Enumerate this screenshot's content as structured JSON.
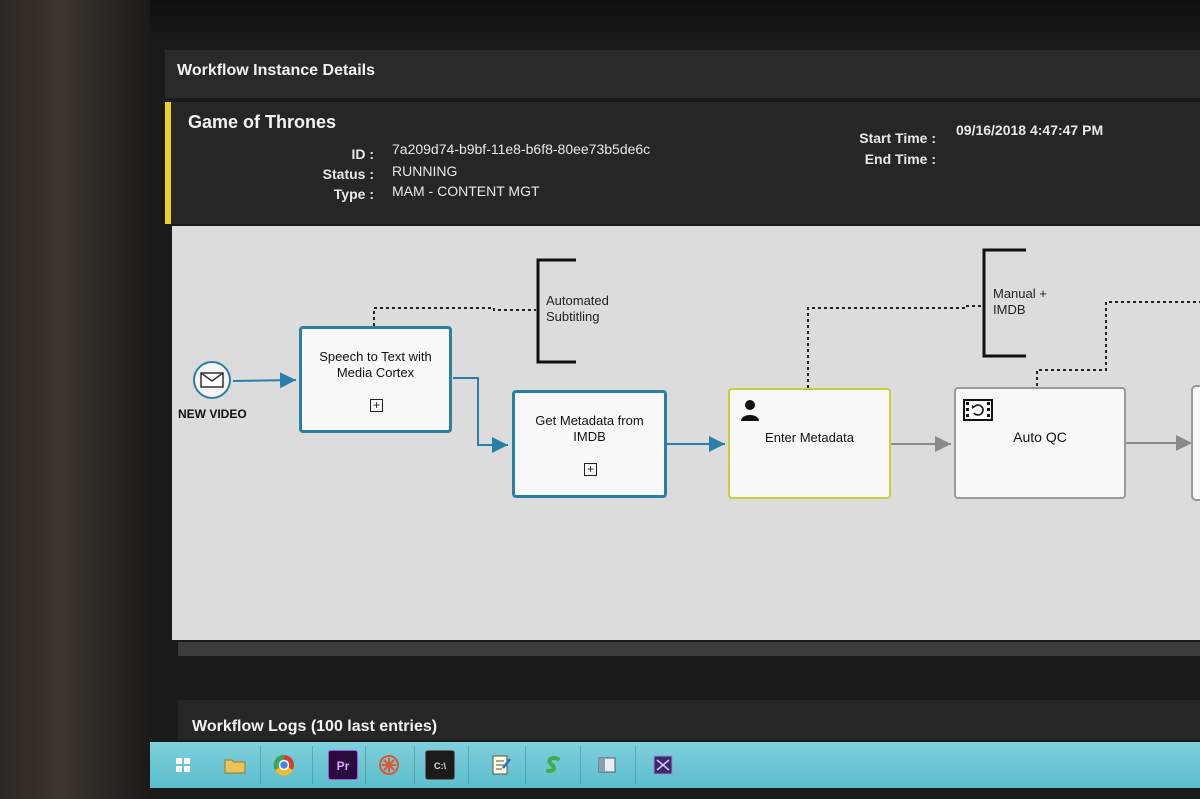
{
  "panel": {
    "title": "Workflow Instance Details"
  },
  "instance": {
    "title": "Game of Thrones",
    "id_label": "ID :",
    "id_value": "7a209d74-b9bf-11e8-b6f8-80ee73b5de6c",
    "status_label": "Status :",
    "status_value": "RUNNING",
    "type_label": "Type :",
    "type_value": "MAM - CONTENT MGT",
    "start_label": "Start Time :",
    "start_value": "09/16/2018 4:47:47 PM",
    "end_label": "End Time :",
    "end_value": ""
  },
  "diagram": {
    "start_event": {
      "label": "NEW VIDEO",
      "icon": "envelope-icon"
    },
    "nodes": [
      {
        "id": "speech",
        "label_1": "Speech to Text with",
        "label_2": "Media Cortex",
        "border": "#2a7fa6",
        "expand": "+"
      },
      {
        "id": "metadata-imdb",
        "label_1": "Get Metadata from",
        "label_2": "IMDB",
        "border": "#2a7fa6",
        "expand": "+"
      },
      {
        "id": "enter-metadata",
        "label_1": "Enter Metadata",
        "border": "#c8cf3a",
        "icon": "user-icon"
      },
      {
        "id": "auto-qc",
        "label_1": "Auto QC",
        "border": "#9a9a9a",
        "icon": "film-icon"
      }
    ],
    "annotations": [
      {
        "line_1": "Automated",
        "line_2": "Subtitling"
      },
      {
        "line_1": "Manual +",
        "line_2": "IMDB"
      }
    ]
  },
  "logs": {
    "title": "Workflow Logs (100 last entries)"
  },
  "taskbar": {
    "icons": [
      "windows-start-icon",
      "file-explorer-icon",
      "chrome-icon",
      "premiere-icon",
      "app-icon",
      "terminal-icon",
      "notepad-icon",
      "app-s-icon",
      "window-icon",
      "app-purple-icon"
    ],
    "premiere_text": "Pr",
    "terminal_text": "C:\\"
  },
  "colors": {
    "accent_yellow": "#e6d21f",
    "flow_blue": "#2a7fa6",
    "user_task_green": "#c8cf3a",
    "taskbar": "#6cc6d4"
  }
}
